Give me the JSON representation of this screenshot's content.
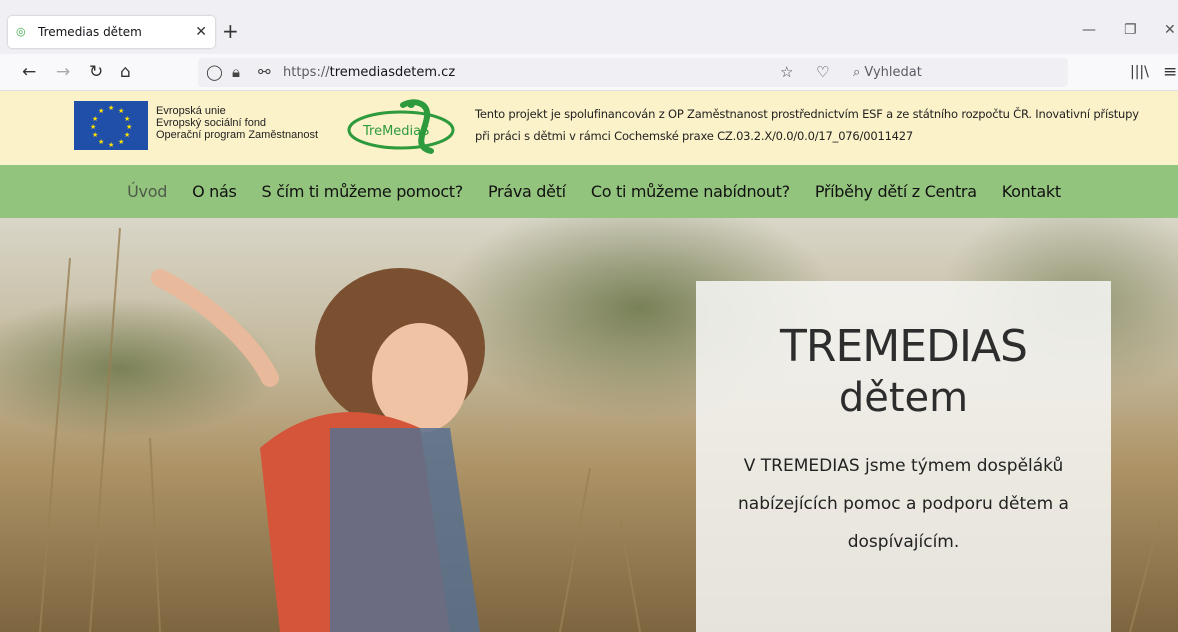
{
  "browser": {
    "tab_title": "Tremedias dětem",
    "url_prefix": "https://",
    "url_domain": "tremediasdetem.cz",
    "search_placeholder": "Vyhledat"
  },
  "esf": {
    "line1": "Evropská unie",
    "line2": "Evropský sociální fond",
    "line3": "Operační program Zaměstnanost",
    "logo_text": "TreMediaS",
    "desc": "Tento projekt je spolufinancován z OP Zaměstnanost prostřednictvím ESF a ze státního rozpočtu ČR. Inovativní přístupy při práci s dětmi v rámci Cochemské praxe CZ.03.2.X/0.0/0.0/17_076/0011427"
  },
  "menu": {
    "items": [
      {
        "label": "Úvod"
      },
      {
        "label": "O nás"
      },
      {
        "label": "S čím ti můžeme pomoct?"
      },
      {
        "label": "Práva dětí"
      },
      {
        "label": "Co ti můžeme nabídnout?"
      },
      {
        "label": "Příběhy dětí z Centra"
      },
      {
        "label": "Kontakt"
      }
    ]
  },
  "hero": {
    "title1": "TREMEDIAS",
    "title2": "dětem",
    "text": "V TREMEDIAS jsme týmem dospěláků nabízejících pomoc a podporu dětem a dospívajícím."
  },
  "colors": {
    "menu_bg": "#93c47d",
    "esf_bg": "#fcf2c9",
    "logo_green": "#2e9a3e"
  }
}
